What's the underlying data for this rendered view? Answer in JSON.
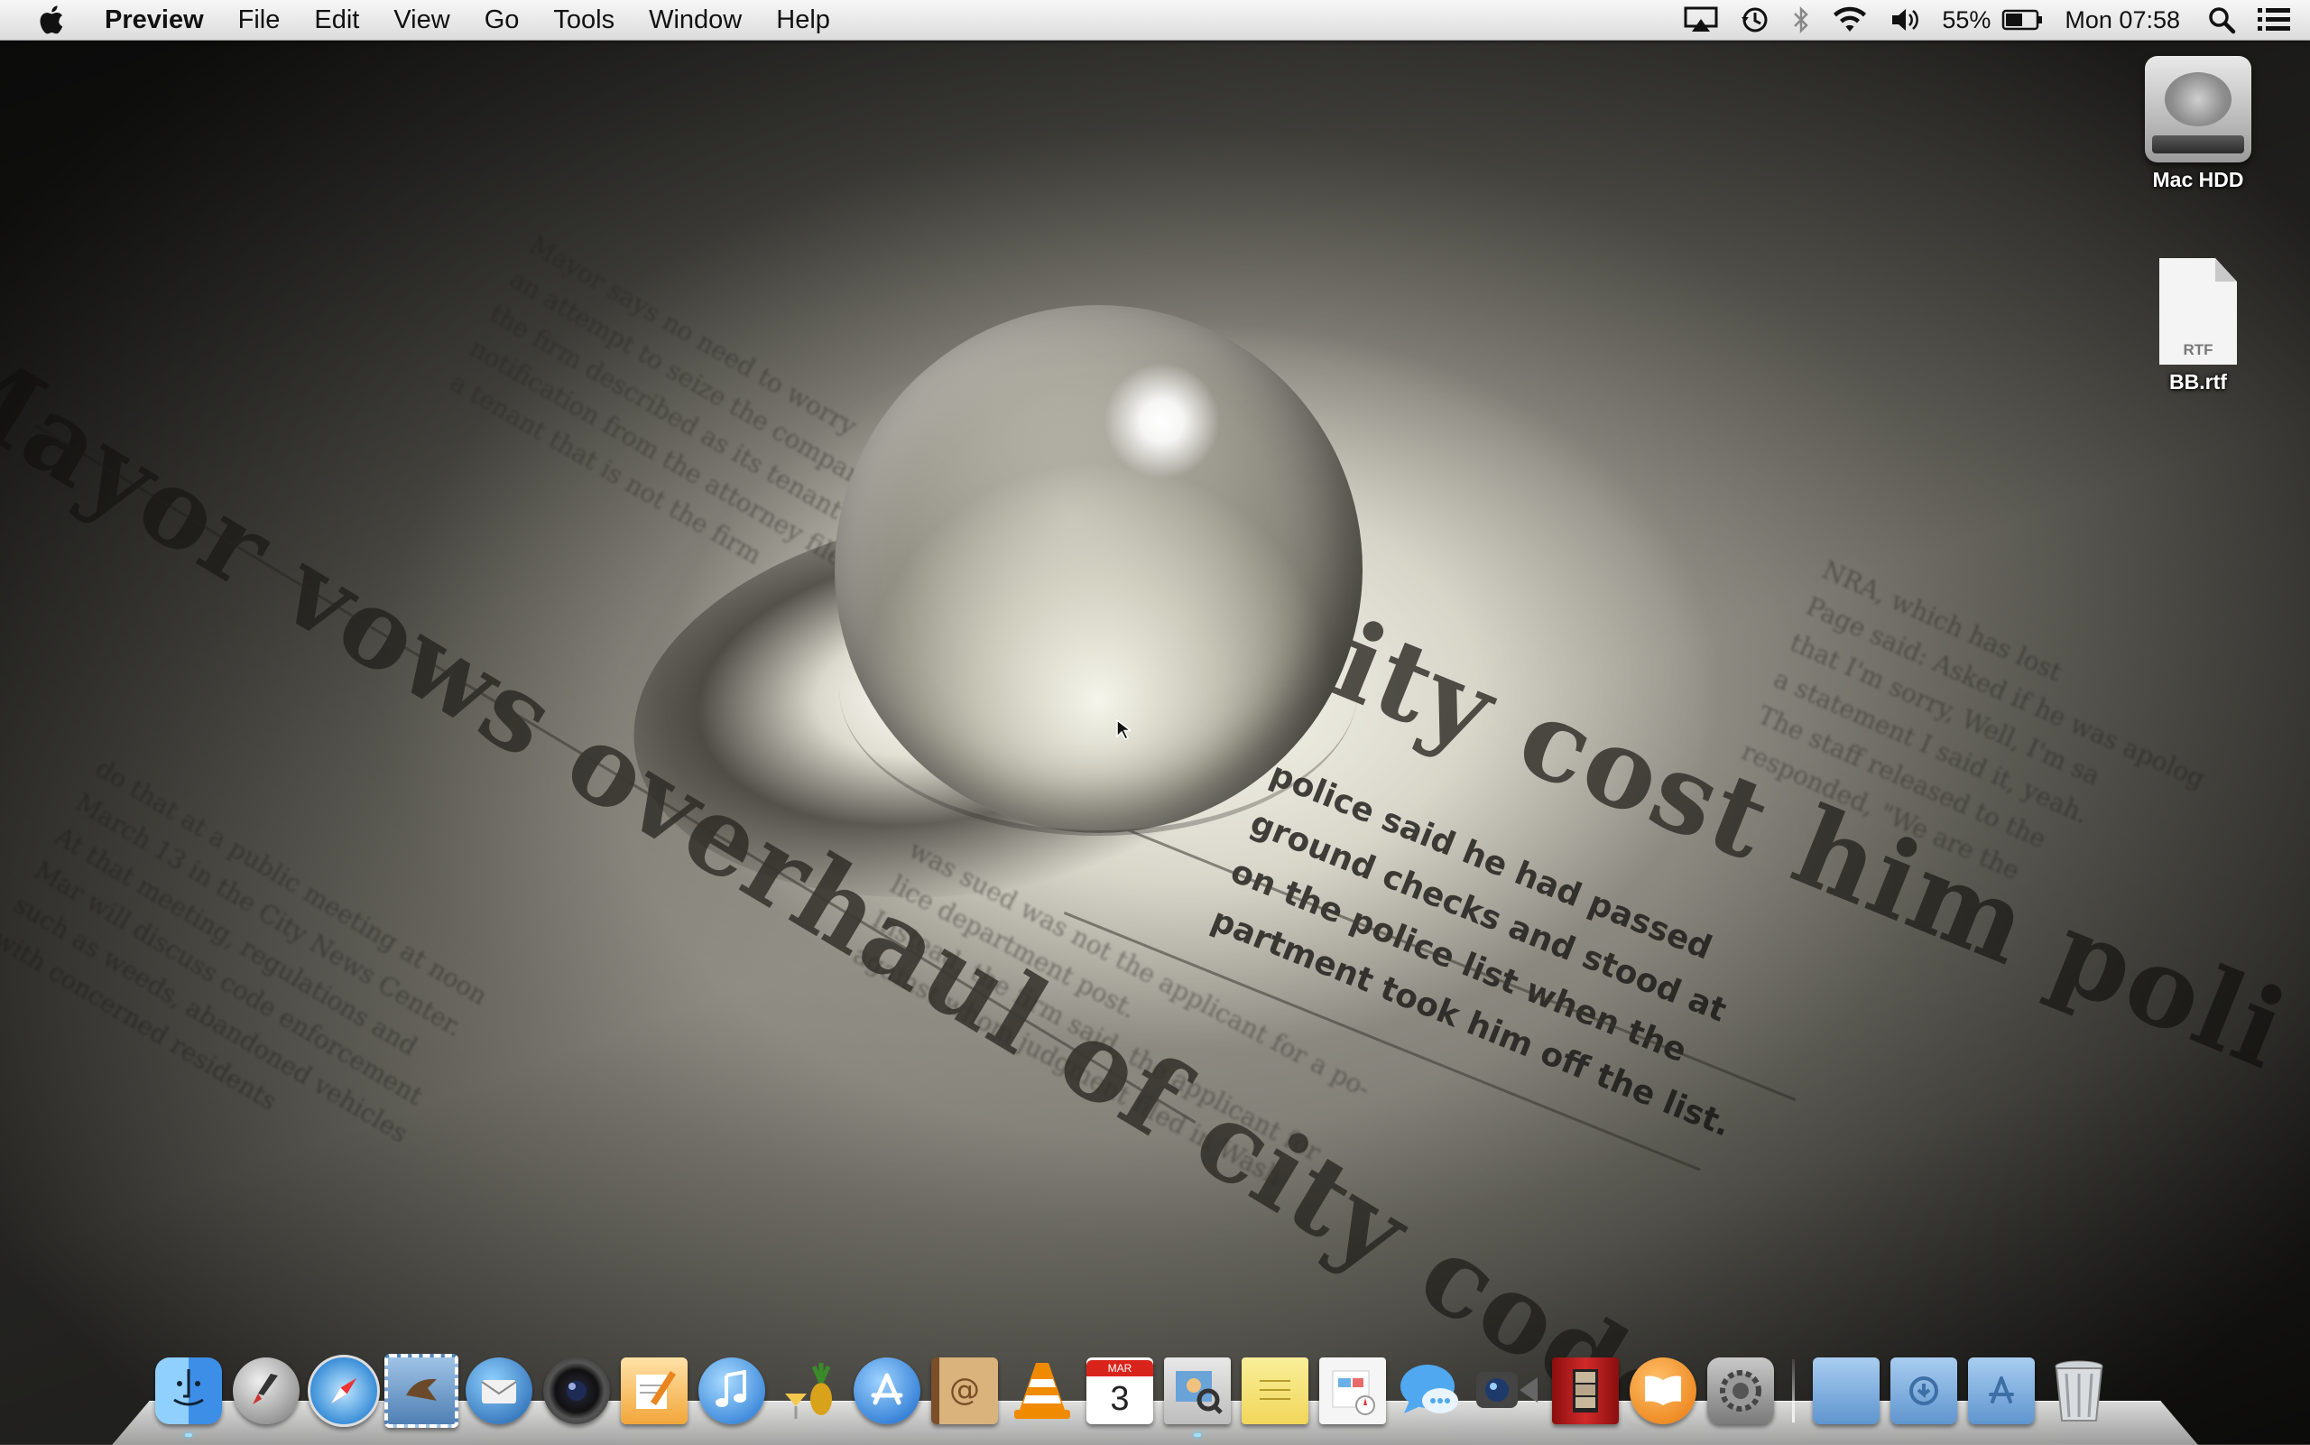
{
  "menubar": {
    "app_name": "Preview",
    "menus": [
      "File",
      "Edit",
      "View",
      "Go",
      "Tools",
      "Window",
      "Help"
    ],
    "status": {
      "battery_percent": "55%",
      "clock": "Mon 07:58"
    }
  },
  "desktop": {
    "icons": [
      {
        "label": "Mac HDD",
        "icon": "hard-drive-icon"
      },
      {
        "label": "BB.rtf",
        "icon": "rtf-document-icon",
        "badge": "RTF"
      }
    ]
  },
  "dock": {
    "calendar_month": "MAR",
    "calendar_day": "3",
    "apps": [
      "finder-icon",
      "launchpad-icon",
      "safari-icon",
      "mail-icon",
      "thunderbird-icon",
      "photo-booth-icon",
      "pages-icon",
      "itunes-icon",
      "iphoto-icon",
      "app-store-icon",
      "contacts-icon",
      "vlc-icon",
      "calendar-icon",
      "preview-icon",
      "notes-icon",
      "reminders-icon",
      "messages-icon",
      "facetime-icon",
      "photo-booth-curtain-icon",
      "ibooks-icon",
      "system-preferences-icon"
    ],
    "stacks": [
      "applications-folder-icon",
      "documents-folder-icon",
      "downloads-folder-icon",
      "trash-icon"
    ]
  },
  "colors": {
    "menubar_bg": "#e6e6e6",
    "running_indicator": "#9fe0ff"
  }
}
